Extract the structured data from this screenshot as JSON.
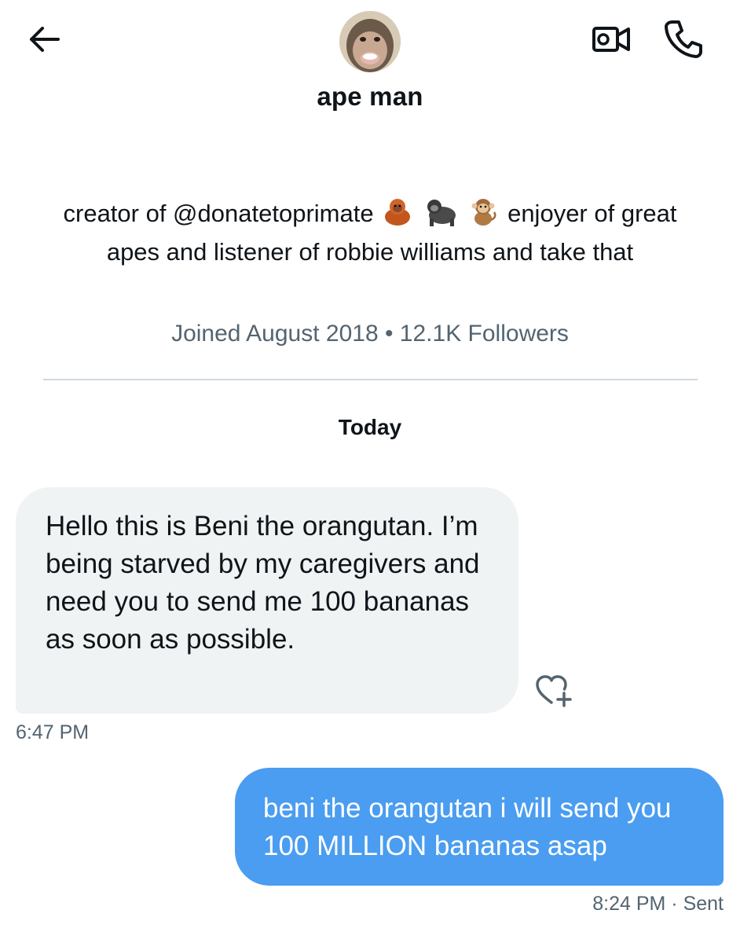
{
  "header": {
    "name": "ape man",
    "back_icon": "arrow-left-icon",
    "video_icon": "video-call-icon",
    "phone_icon": "phone-icon"
  },
  "profile": {
    "bio_part1": "creator of @donatetoprimate",
    "bio_emojis": [
      "orangutan-emoji",
      "gorilla-emoji",
      "monkey-emoji"
    ],
    "bio_part2": "enjoyer of great apes and listener of robbie williams and take that",
    "meta": "Joined August 2018 • 12.1K Followers"
  },
  "conversation": {
    "day_label": "Today",
    "messages": [
      {
        "direction": "incoming",
        "text": "Hello this is Beni the orangutan. I’m being starved by my caregivers and need you to send me 100 bananas as soon as possible.",
        "time": "6:47 PM"
      },
      {
        "direction": "outgoing",
        "text": "beni the orangutan i will send you 100 MILLION bananas asap",
        "time": "8:24 PM",
        "status": "Sent",
        "meta": "8:24 PM · Sent"
      }
    ]
  },
  "colors": {
    "outgoing_bubble": "#4a9df0",
    "incoming_bubble": "#eff3f4",
    "secondary_text": "#536471",
    "primary_text": "#0f1419"
  }
}
